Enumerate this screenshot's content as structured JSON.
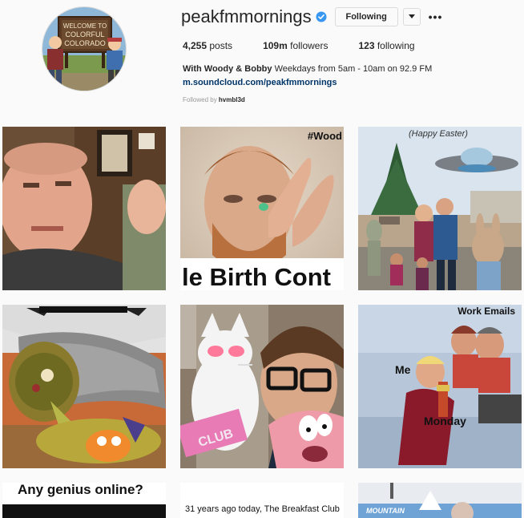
{
  "profile": {
    "username": "peakfmmornings",
    "avatar_text": [
      "WELCOME TO",
      "COLORFUL",
      "COLORADO"
    ],
    "follow_label": "Following",
    "stats": [
      {
        "value": "4,255",
        "label": "posts"
      },
      {
        "value": "109m",
        "label": "followers"
      },
      {
        "value": "123",
        "label": "following"
      }
    ],
    "bio_name": "With Woody & Bobby",
    "bio_text": "Weekdays from 5am - 10am on 92.9 FM",
    "bio_link": "m.soundcloud.com/peakfmmornings",
    "followed_prefix": "Followed by",
    "followed_user": "hvmbl3d"
  },
  "colors": {
    "verified": "#3897f0",
    "link": "#003569",
    "border": "#dbdbdb"
  },
  "posts": [
    {
      "caption": ""
    },
    {
      "caption_top": "#Wood",
      "caption_bottom": "le Birth Cont"
    },
    {
      "caption": "(Happy Easter)"
    },
    {
      "caption": ""
    },
    {
      "caption": "CLUB"
    },
    {
      "caption_top": "Work Emails",
      "caption_mid": "Me",
      "caption_bottom": "Monday"
    },
    {
      "caption": "Any genius online?"
    },
    {
      "caption": "31 years ago today, The Breakfast Club"
    },
    {
      "caption": "MOUNTAIN"
    }
  ]
}
